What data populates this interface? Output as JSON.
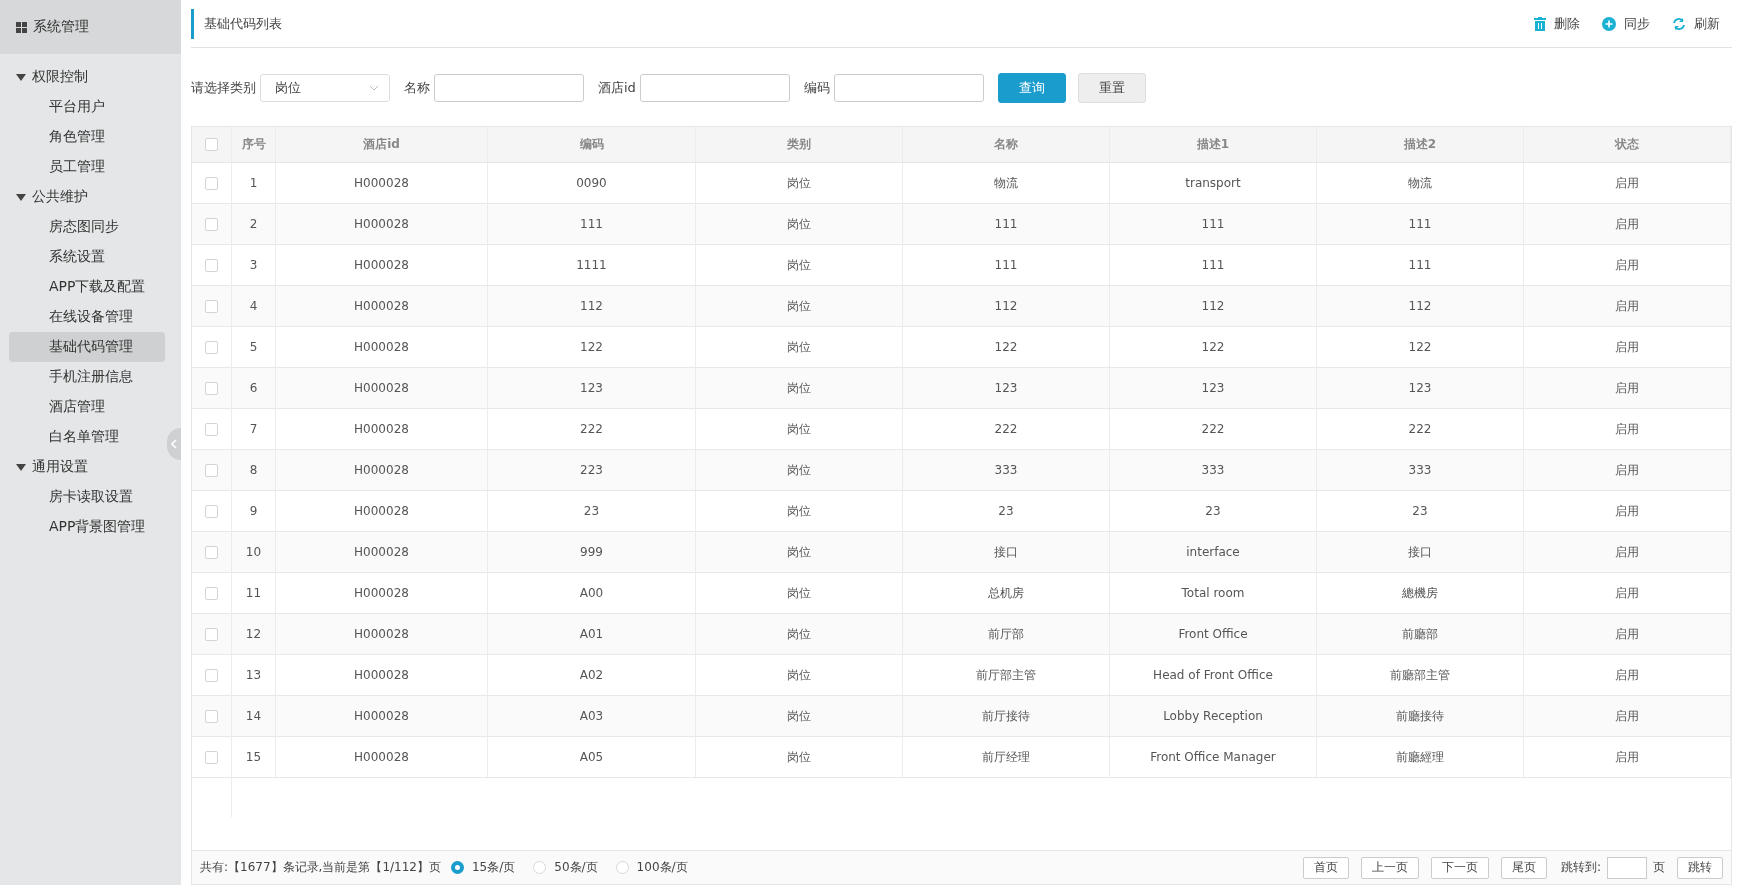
{
  "sidebar": {
    "title": "系统管理",
    "groups": [
      {
        "label": "权限控制",
        "expanded": true,
        "children": [
          {
            "label": "平台用户",
            "selected": false
          },
          {
            "label": "角色管理",
            "selected": false
          },
          {
            "label": "员工管理",
            "selected": false
          }
        ]
      },
      {
        "label": "公共维护",
        "expanded": true,
        "children": [
          {
            "label": "房态图同步",
            "selected": false
          },
          {
            "label": "系统设置",
            "selected": false
          },
          {
            "label": "APP下载及配置",
            "selected": false
          },
          {
            "label": "在线设备管理",
            "selected": false
          },
          {
            "label": "基础代码管理",
            "selected": true
          },
          {
            "label": "手机注册信息",
            "selected": false
          },
          {
            "label": "酒店管理",
            "selected": false
          },
          {
            "label": "白名单管理",
            "selected": false
          }
        ]
      },
      {
        "label": "通用设置",
        "expanded": true,
        "children": [
          {
            "label": "房卡读取设置",
            "selected": false
          },
          {
            "label": "APP背景图管理",
            "selected": false
          }
        ]
      }
    ]
  },
  "page_title": "基础代码列表",
  "actions": [
    {
      "kind": "delete",
      "label": "删除"
    },
    {
      "kind": "sync",
      "label": "同步"
    },
    {
      "kind": "refresh",
      "label": "刷新"
    }
  ],
  "filters": {
    "category_label": "请选择类别",
    "category_value": "岗位",
    "fields": [
      {
        "label": "名称"
      },
      {
        "label": "酒店id"
      },
      {
        "label": "编码"
      }
    ],
    "buttons": [
      {
        "kind": "primary",
        "label": "查询"
      },
      {
        "kind": "default",
        "label": "重置"
      }
    ]
  },
  "table": {
    "select_all_checked": false,
    "columns": [
      "序号",
      "酒店id",
      "编码",
      "类别",
      "名称",
      "描述1",
      "描述2",
      "状态"
    ],
    "rows": [
      {
        "checked": false,
        "cells": [
          "1",
          "H000028",
          "0090",
          "岗位",
          "物流",
          "transport",
          "物流",
          "启用"
        ]
      },
      {
        "checked": false,
        "cells": [
          "2",
          "H000028",
          "111",
          "岗位",
          "111",
          "111",
          "111",
          "启用"
        ]
      },
      {
        "checked": false,
        "cells": [
          "3",
          "H000028",
          "1111",
          "岗位",
          "111",
          "111",
          "111",
          "启用"
        ]
      },
      {
        "checked": false,
        "cells": [
          "4",
          "H000028",
          "112",
          "岗位",
          "112",
          "112",
          "112",
          "启用"
        ]
      },
      {
        "checked": false,
        "cells": [
          "5",
          "H000028",
          "122",
          "岗位",
          "122",
          "122",
          "122",
          "启用"
        ]
      },
      {
        "checked": false,
        "cells": [
          "6",
          "H000028",
          "123",
          "岗位",
          "123",
          "123",
          "123",
          "启用"
        ]
      },
      {
        "checked": false,
        "cells": [
          "7",
          "H000028",
          "222",
          "岗位",
          "222",
          "222",
          "222",
          "启用"
        ]
      },
      {
        "checked": false,
        "cells": [
          "8",
          "H000028",
          "223",
          "岗位",
          "333",
          "333",
          "333",
          "启用"
        ]
      },
      {
        "checked": false,
        "cells": [
          "9",
          "H000028",
          "23",
          "岗位",
          "23",
          "23",
          "23",
          "启用"
        ]
      },
      {
        "checked": false,
        "cells": [
          "10",
          "H000028",
          "999",
          "岗位",
          "接口",
          "interface",
          "接口",
          "启用"
        ]
      },
      {
        "checked": false,
        "cells": [
          "11",
          "H000028",
          "A00",
          "岗位",
          "总机房",
          "Total room",
          "總機房",
          "启用"
        ]
      },
      {
        "checked": false,
        "cells": [
          "12",
          "H000028",
          "A01",
          "岗位",
          "前厅部",
          "Front Office",
          "前廳部",
          "启用"
        ]
      },
      {
        "checked": false,
        "cells": [
          "13",
          "H000028",
          "A02",
          "岗位",
          "前厅部主管",
          "Head of Front Office",
          "前廳部主管",
          "启用"
        ]
      },
      {
        "checked": false,
        "cells": [
          "14",
          "H000028",
          "A03",
          "岗位",
          "前厅接待",
          "Lobby Reception",
          "前廳接待",
          "启用"
        ]
      },
      {
        "checked": false,
        "cells": [
          "15",
          "H000028",
          "A05",
          "岗位",
          "前厅经理",
          "Front Office Manager",
          "前廳經理",
          "启用"
        ]
      }
    ]
  },
  "pagination": {
    "summary": "共有:【1677】条记录,当前是第【1/112】页",
    "page_sizes": [
      {
        "label": "15条/页",
        "selected": true
      },
      {
        "label": "50条/页",
        "selected": false
      },
      {
        "label": "100条/页",
        "selected": false
      }
    ],
    "buttons": [
      "首页",
      "上一页",
      "下一页",
      "尾页"
    ],
    "jump_label": "跳转到:",
    "page_unit": "页",
    "jump_button": "跳转"
  }
}
